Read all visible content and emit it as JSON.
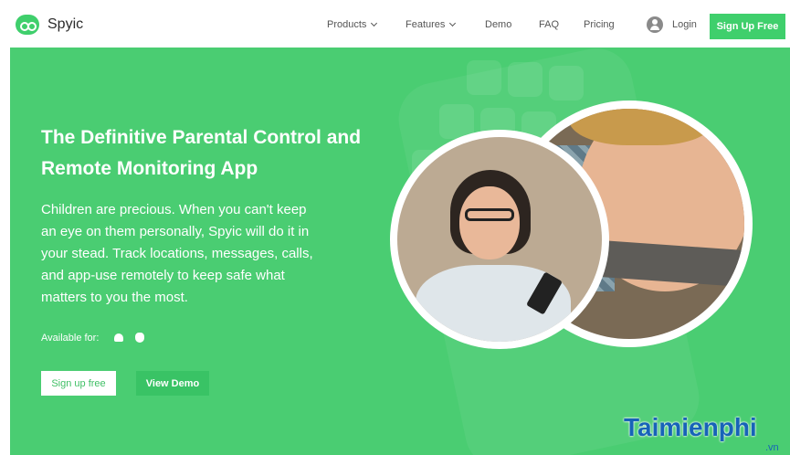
{
  "brand": {
    "name": "Spyic",
    "accent": "#3fcf6c"
  },
  "nav": {
    "products": "Products",
    "features": "Features",
    "demo": "Demo",
    "faq": "FAQ",
    "pricing": "Pricing",
    "login": "Login",
    "signup": "Sign Up Free"
  },
  "hero": {
    "background": "#4acd72",
    "headline": "The Definitive Parental Control and Remote Monitoring App",
    "description": "Children are precious. When you can't keep an eye on them personally, Spyic will do it in your stead. Track locations, messages, calls, and app-use remotely to keep safe what matters to you the most.",
    "available_for": "Available for:",
    "platforms": [
      "android-icon",
      "apple-icon"
    ],
    "signup_button": "Sign up free",
    "demo_button": "View Demo"
  },
  "watermark": {
    "main": "Taimienphi",
    "sub": ".vn"
  }
}
